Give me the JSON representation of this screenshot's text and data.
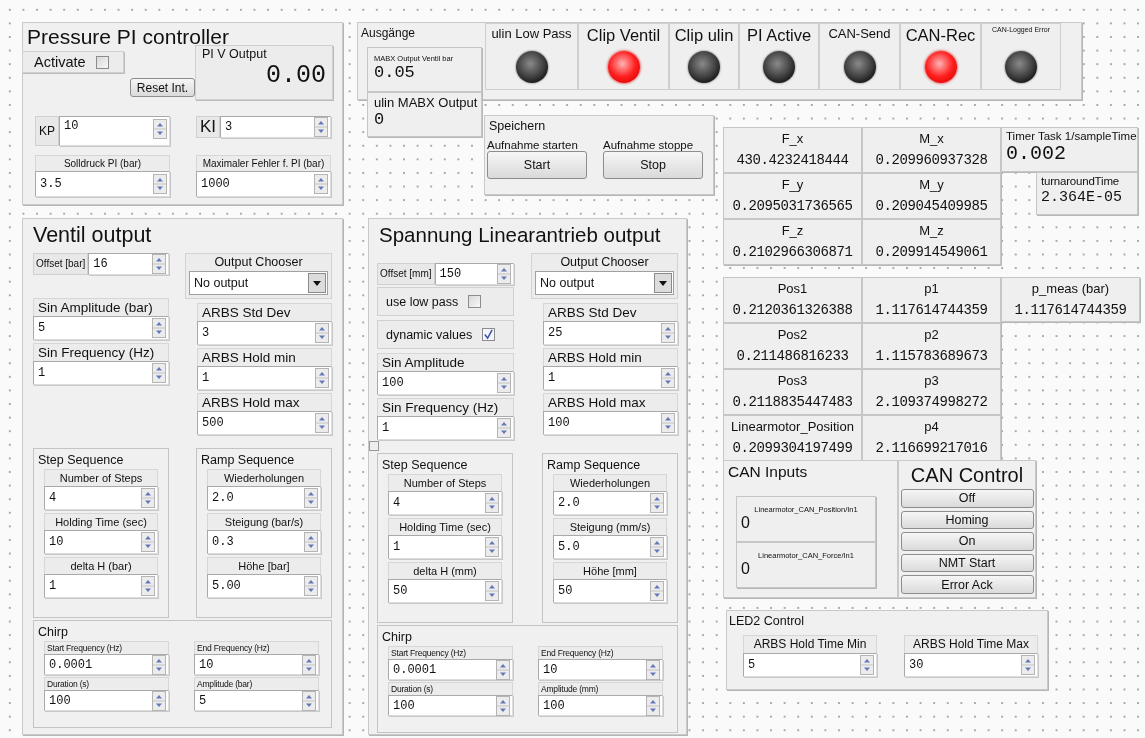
{
  "pressure_pi": {
    "title": "Pressure PI controller",
    "activate": {
      "label": "Activate",
      "checked": false
    },
    "reset_button": "Reset Int.",
    "output": {
      "label": "PI V Output",
      "value": "0.00"
    },
    "fields": [
      {
        "kind": "inline",
        "label": "KP",
        "value": "10"
      },
      {
        "kind": "inline",
        "label": "KI",
        "value": "3"
      },
      {
        "kind": "number",
        "label": "Solldruck PI (bar)",
        "value": "3.5"
      },
      {
        "kind": "number",
        "label": "Maximaler Fehler f. PI (bar)",
        "value": "1000"
      }
    ]
  },
  "ausgaenge": {
    "title": "Ausgänge",
    "readouts": [
      {
        "label": "MABX Output Ventil bar",
        "value": "0.05"
      },
      {
        "label": "ulin MABX Output",
        "value": "0"
      }
    ],
    "leds": [
      {
        "label": "ulin Low Pass",
        "on": false
      },
      {
        "label": "Clip Ventil",
        "on": true
      },
      {
        "label": "Clip ulin",
        "on": false
      },
      {
        "label": "PI Active",
        "on": false
      },
      {
        "label": "CAN-Send",
        "on": false
      },
      {
        "label": "CAN-Rec",
        "on": true
      },
      {
        "label": "CAN-Logged Error",
        "on": false
      }
    ]
  },
  "speichern": {
    "title": "Speichern",
    "buttons": [
      {
        "label": "Aufnahme starten",
        "button": "Start"
      },
      {
        "label": "Aufnahme stoppe",
        "button": "Stop"
      }
    ]
  },
  "force_table": [
    {
      "label": "F_x",
      "value": "430.4232418444"
    },
    {
      "label": "M_x",
      "value": "0.209960937328"
    },
    {
      "label": "F_y",
      "value": "0.2095031736565"
    },
    {
      "label": "M_y",
      "value": "0.209045409985"
    },
    {
      "label": "F_z",
      "value": "0.2102966306871"
    },
    {
      "label": "M_z",
      "value": "0.209914549061"
    }
  ],
  "timing": [
    {
      "label": "Timer Task 1/sampleTime",
      "value": "0.002"
    },
    {
      "label": "turnaroundTime",
      "value": "2.364E-05"
    }
  ],
  "position_table": [
    {
      "label": "Pos1",
      "value": "0.2120361326388"
    },
    {
      "label": "p1",
      "value": "1.117614744359"
    },
    {
      "label": "Pos2",
      "value": "0.211486816233"
    },
    {
      "label": "p2",
      "value": "1.115783689673"
    },
    {
      "label": "Pos3",
      "value": "0.2118835447483"
    },
    {
      "label": "p3",
      "value": "2.109374998272"
    },
    {
      "label": "Linearmotor_Position",
      "value": "0.2099304197499"
    },
    {
      "label": "p4",
      "value": "2.116699217016"
    }
  ],
  "p_meas": {
    "label": "p_meas (bar)",
    "value": "1.117614744359"
  },
  "ventil_output": {
    "title": "Ventil output",
    "left": [
      {
        "kind": "inline",
        "label": "Offset [bar]",
        "value": "16"
      },
      {
        "kind": "number",
        "label": "Sin Amplitude (bar)",
        "value": "5"
      },
      {
        "kind": "number",
        "label": "Sin Frequency (Hz)",
        "value": "1"
      }
    ],
    "right": [
      {
        "kind": "dropdown",
        "label": "Output Chooser",
        "value": "No output"
      },
      {
        "kind": "number",
        "label": "ARBS Std Dev",
        "value": "3"
      },
      {
        "kind": "number",
        "label": "ARBS Hold min",
        "value": "1"
      },
      {
        "kind": "number",
        "label": "ARBS Hold max",
        "value": "500"
      }
    ],
    "groups": [
      {
        "title": "Step Sequence",
        "fields": [
          {
            "label": "Number of Steps",
            "value": "4"
          },
          {
            "label": "Holding Time (sec)",
            "value": "10"
          },
          {
            "label": "delta H (bar)",
            "value": "1"
          }
        ]
      },
      {
        "title": "Ramp Sequence",
        "fields": [
          {
            "label": "Wiederholungen",
            "value": "2.0"
          },
          {
            "label": "Steigung (bar/s)",
            "value": "0.3"
          },
          {
            "label": "Höhe [bar]",
            "value": "5.00"
          }
        ]
      }
    ],
    "chirp": {
      "title": "Chirp",
      "fields": [
        {
          "label": "Start Frequency (Hz)",
          "value": "0.0001"
        },
        {
          "label": "End Frequency (Hz)",
          "value": "10"
        },
        {
          "label": "Duration (s)",
          "value": "100"
        },
        {
          "label": "Amplitude (bar)",
          "value": "5"
        }
      ]
    }
  },
  "spannung_output": {
    "title": "Spannung Linearantrieb output",
    "left": [
      {
        "kind": "inline",
        "label": "Offset [mm]",
        "value": "150"
      },
      {
        "kind": "checkbox",
        "label": "use low pass",
        "checked": false
      },
      {
        "kind": "checkbox",
        "label": "dynamic values",
        "checked": true
      },
      {
        "kind": "number",
        "label": "Sin Amplitude",
        "value": "100"
      },
      {
        "kind": "number",
        "label": "Sin Frequency (Hz)",
        "value": "1"
      }
    ],
    "right": [
      {
        "kind": "dropdown",
        "label": "Output Chooser",
        "value": "No output"
      },
      {
        "kind": "number",
        "label": "ARBS Std Dev",
        "value": "25"
      },
      {
        "kind": "number",
        "label": "ARBS Hold min",
        "value": "1"
      },
      {
        "kind": "number",
        "label": "ARBS Hold max",
        "value": "100"
      }
    ],
    "groups": [
      {
        "title": "Step Sequence",
        "fields": [
          {
            "label": "Number of Steps",
            "value": "4"
          },
          {
            "label": "Holding Time (sec)",
            "value": "1"
          },
          {
            "label": "delta H (mm)",
            "value": "50"
          }
        ]
      },
      {
        "title": "Ramp Sequence",
        "fields": [
          {
            "label": "Wiederholungen",
            "value": "2.0"
          },
          {
            "label": "Steigung (mm/s)",
            "value": "5.0"
          },
          {
            "label": "Höhe [mm]",
            "value": "50"
          }
        ]
      }
    ],
    "chirp": {
      "title": "Chirp",
      "fields": [
        {
          "label": "Start Frequency (Hz)",
          "value": "0.0001"
        },
        {
          "label": "End Frequency (Hz)",
          "value": "10"
        },
        {
          "label": "Duration (s)",
          "value": "100"
        },
        {
          "label": "Amplitude (mm)",
          "value": "100"
        }
      ]
    }
  },
  "can_inputs": {
    "title": "CAN Inputs",
    "readouts": [
      {
        "label": "Linearmotor_CAN_Position/In1",
        "value": "0"
      },
      {
        "label": "Linearmotor_CAN_Force/In1",
        "value": "0"
      }
    ]
  },
  "can_control": {
    "title": "CAN Control",
    "buttons": [
      "Off",
      "Homing",
      "On",
      "NMT Start",
      "Error Ack"
    ]
  },
  "led2_control": {
    "title": "LED2 Control",
    "fields": [
      {
        "label": "ARBS Hold Time Min",
        "value": "5"
      },
      {
        "label": "ARBS Hold Time Max",
        "value": "30"
      }
    ]
  }
}
